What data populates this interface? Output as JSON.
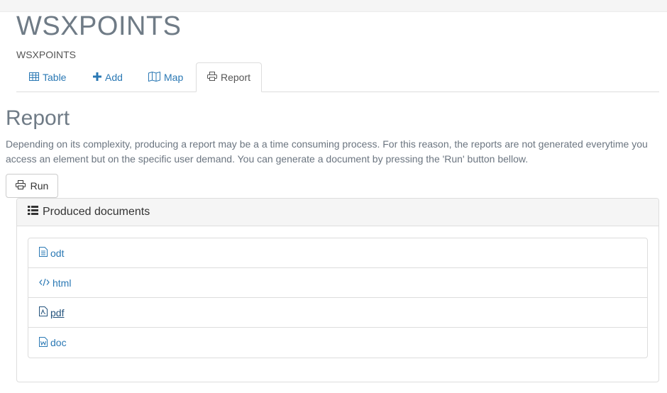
{
  "header": {
    "title": "WSXPOINTS",
    "subtitle": "WSXPOINTS"
  },
  "tabs": [
    {
      "label": "Table",
      "icon": "table-icon",
      "active": false
    },
    {
      "label": "Add",
      "icon": "plus-icon",
      "active": false
    },
    {
      "label": "Map",
      "icon": "map-icon",
      "active": false
    },
    {
      "label": "Report",
      "icon": "print-icon",
      "active": true
    }
  ],
  "report": {
    "title": "Report",
    "description": "Depending on its complexity, producing a report may be a a time consuming process. For this reason, the reports are not generated everytime you access an element but on the specific user demand. You can generate a document by pressing the 'Run' button bellow.",
    "run_label": "Run"
  },
  "panel": {
    "heading": "Produced documents",
    "documents": [
      {
        "label": "odt",
        "icon": "file-text-icon"
      },
      {
        "label": "html",
        "icon": "code-icon"
      },
      {
        "label": "pdf",
        "icon": "file-pdf-icon"
      },
      {
        "label": "doc",
        "icon": "file-word-icon"
      }
    ]
  },
  "colors": {
    "link": "#2a78b4",
    "muted_heading": "#6f7b86",
    "border": "#dddddd",
    "panel_heading_bg": "#f5f5f5"
  }
}
